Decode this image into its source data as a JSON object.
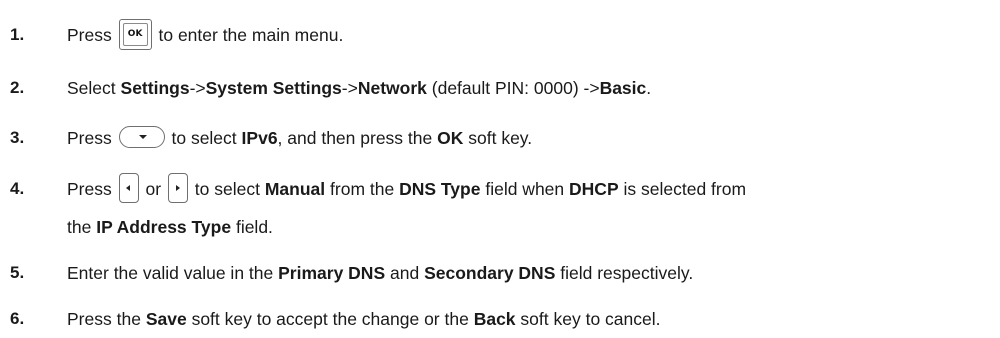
{
  "steps": [
    {
      "num": "1.",
      "t1": "Press",
      "key": "OK",
      "t2": "to enter the main menu."
    },
    {
      "num": "2.",
      "t1": "Select",
      "b1": "Settings",
      "t2": "->",
      "b2": "System Settings",
      "t3": "->",
      "b3": "Network",
      "t4": "(default PIN: 0000) ->",
      "b4": "Basic",
      "t5": "."
    },
    {
      "num": "3.",
      "t1": "Press",
      "t2": "to select",
      "b1": "IPv6",
      "t3": ", and then press the",
      "b2": "OK",
      "t4": "soft key."
    },
    {
      "num": "4.",
      "t1": "Press",
      "t2": "or",
      "t3": "to select",
      "b1": "Manual",
      "t4": "from the",
      "b2": "DNS Type",
      "t5": "field when",
      "b3": "DHCP",
      "t6": "is selected from",
      "t7": "the",
      "b4": "IP Address Type",
      "t8": "field."
    },
    {
      "num": "5.",
      "t1": "Enter the valid value in the",
      "b1": "Primary DNS",
      "t2": "and",
      "b2": "Secondary DNS",
      "t3": "field respectively."
    },
    {
      "num": "6.",
      "t1": "Press the",
      "b1": "Save",
      "t2": "soft key to accept the change or the",
      "b2": "Back",
      "t3": "soft key to cancel."
    }
  ],
  "icons": {
    "ok_key": "ok-key-icon",
    "down_key": "down-navigation-key-icon",
    "left_key": "left-navigation-key-icon",
    "right_key": "right-navigation-key-icon"
  }
}
